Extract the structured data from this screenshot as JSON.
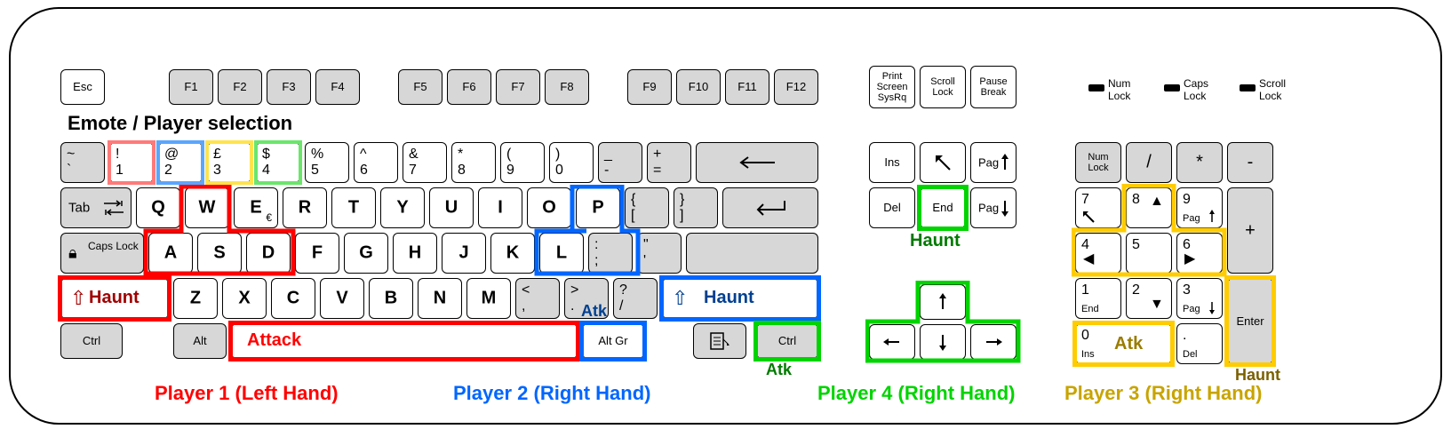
{
  "title_annotation": "Emote / Player selection",
  "players": {
    "p1": {
      "label": "Player 1 (Left Hand)",
      "color": "#ff0000"
    },
    "p2": {
      "label": "Player 2 (Right Hand)",
      "color": "#0066ff"
    },
    "p3": {
      "label": "Player 3 (Right Hand)",
      "color": "#c8a400"
    },
    "p4": {
      "label": "Player 4 (Right Hand)",
      "color": "#00d400"
    }
  },
  "action_labels": {
    "p1_haunt": "Haunt",
    "p1_attack": "Attack",
    "p2_haunt": "Haunt",
    "p2_atk": "Atk",
    "p3_atk": "Atk",
    "p3_haunt": "Haunt",
    "p4_haunt": "Haunt",
    "p4_atk": "Atk"
  },
  "locks": {
    "num": "Num Lock",
    "caps": "Caps Lock",
    "scroll": "Scroll Lock"
  },
  "keys": {
    "esc": "Esc",
    "f1": "F1",
    "f2": "F2",
    "f3": "F3",
    "f4": "F4",
    "f5": "F5",
    "f6": "F6",
    "f7": "F7",
    "f8": "F8",
    "f9": "F9",
    "f10": "F10",
    "f11": "F11",
    "f12": "F12",
    "backtick_top": "~",
    "backtick_bot": "`",
    "n1_top": "!",
    "n1_bot": "1",
    "n2_top": "@",
    "n2_bot": "2",
    "n3_top": "£",
    "n3_bot": "3",
    "n4_top": "$",
    "n4_bot": "4",
    "n5_top": "%",
    "n5_bot": "5",
    "n6_top": "^",
    "n6_bot": "6",
    "n7_top": "&",
    "n7_bot": "7",
    "n8_top": "*",
    "n8_bot": "8",
    "n9_top": "(",
    "n9_bot": "9",
    "n0_top": ")",
    "n0_bot": "0",
    "minus_top": "_",
    "minus_bot": "-",
    "plus_top": "+",
    "plus_bot": "=",
    "tab": "Tab",
    "q": "Q",
    "w": "W",
    "e": "E",
    "e_sub": "€",
    "r": "R",
    "t": "T",
    "y": "Y",
    "u": "U",
    "i": "I",
    "o": "O",
    "p": "P",
    "brkl_top": "{",
    "brkl_bot": "[",
    "brkr_top": "}",
    "brkr_bot": "]",
    "caps": "Caps Lock",
    "a": "A",
    "s": "S",
    "d": "D",
    "f": "F",
    "g": "G",
    "h": "H",
    "j": "J",
    "k": "K",
    "l": "L",
    "semi_top": ":",
    "semi_bot": ";",
    "quote_top": "\"",
    "quote_bot": "'",
    "z": "Z",
    "x": "X",
    "c": "C",
    "v": "V",
    "b": "B",
    "n": "N",
    "m": "M",
    "comma_top": "<",
    "comma_bot": ",",
    "period_top": ">",
    "period_bot": ".",
    "slash_top": "?",
    "slash_bot": "/",
    "lctrl": "Ctrl",
    "lalt": "Alt",
    "altgr": "Alt Gr",
    "rctrl": "Ctrl",
    "prtsc": "Print Screen SysRq",
    "scrlk": "Scroll Lock",
    "pause": "Pause Break",
    "ins": "Ins",
    "del": "Del",
    "end": "End",
    "pgup": "Pag",
    "pgdn": "Pag",
    "numlock": "Num Lock",
    "np_div": "/",
    "np_mul": "*",
    "np_sub": "-",
    "np_add": "+",
    "np7": "7",
    "np8": "8",
    "np9": "9",
    "np9_sub": "Pag",
    "np4": "4",
    "np5": "5",
    "np6": "6",
    "np1": "1",
    "np1_sub": "End",
    "np2": "2",
    "np3": "3",
    "np3_sub": "Pag",
    "np0": "0",
    "np0_sub": "Ins",
    "npdot": ".",
    "npdot_sub": "Del",
    "np_enter": "Enter"
  }
}
